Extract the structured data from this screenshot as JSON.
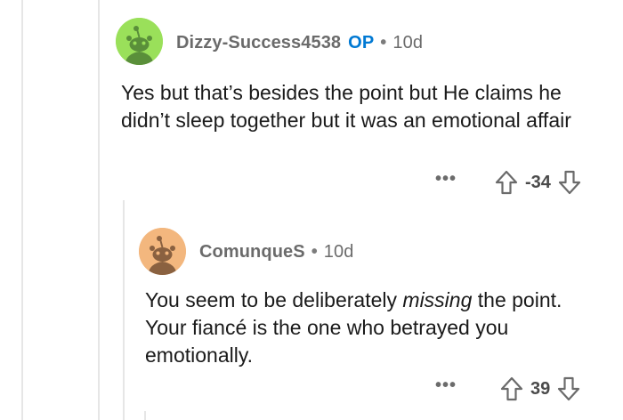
{
  "comments": [
    {
      "username": "Dizzy-Success4538",
      "badge": "OP",
      "separator": "•",
      "age": "10d",
      "avatar_color": "#9ae05a",
      "body": "Yes but that’s besides the point but He claims he didn’t sleep together but it was an emotional affair",
      "more_label": "•••",
      "score": "-34"
    },
    {
      "username": "ComunqueS",
      "separator": "•",
      "age": "10d",
      "avatar_color": "#f3b77e",
      "body_parts": {
        "before": "You seem to be deliberately ",
        "emphasis": "missing",
        "after": " the point. Your fiancé is the one who betrayed you emotionally."
      },
      "more_label": "•••",
      "score": "39"
    }
  ],
  "colors": {
    "thread_line": "#e6e6e6",
    "op_badge": "#0079d3",
    "meta_text": "#6b6b6b",
    "body_text": "#1a1a1a"
  }
}
